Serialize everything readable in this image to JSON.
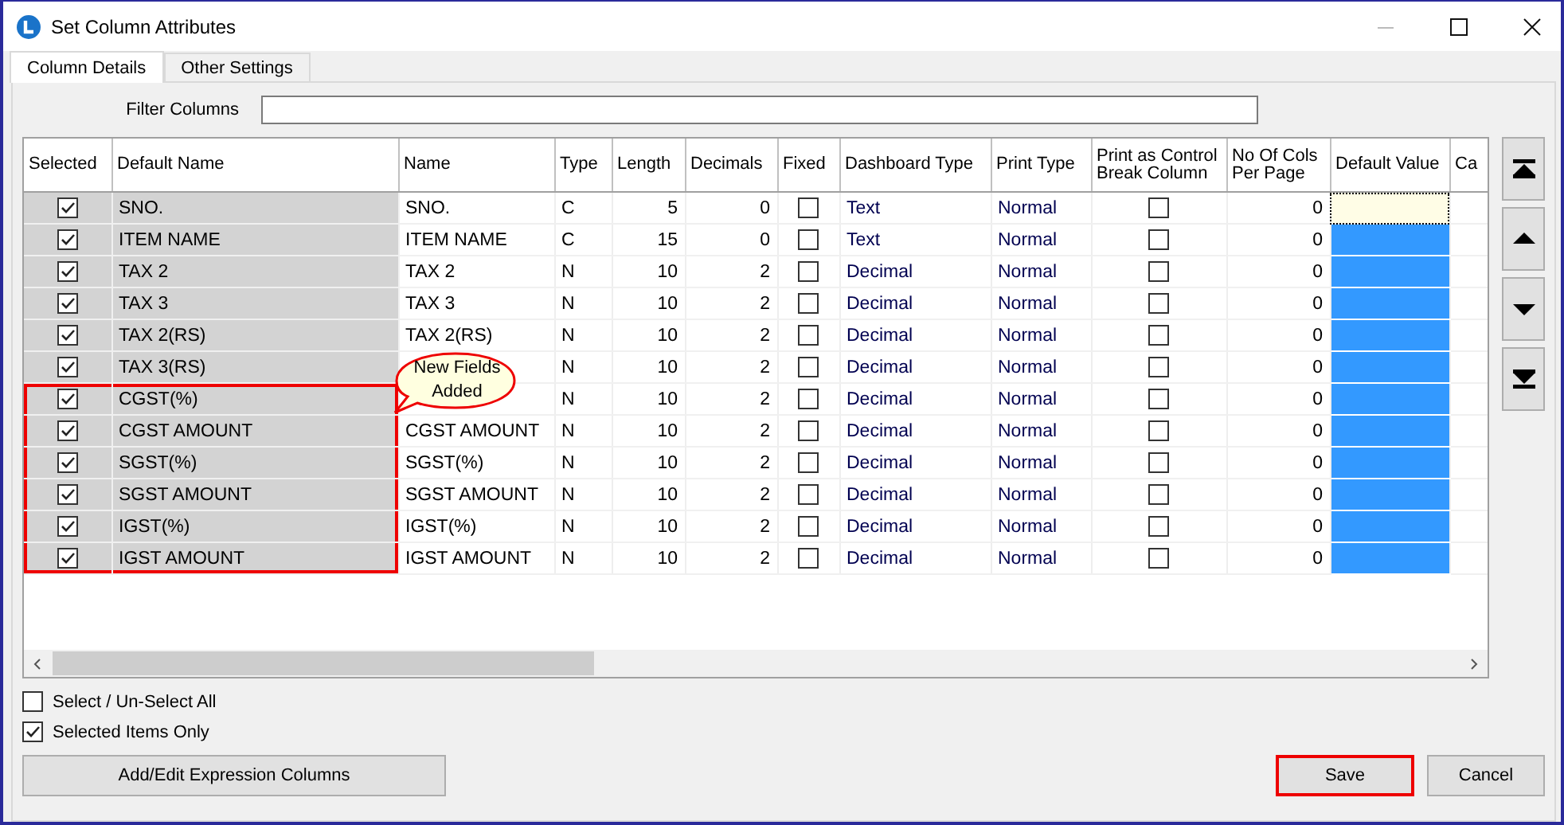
{
  "window": {
    "title": "Set Column Attributes"
  },
  "tabs": [
    {
      "label": "Column Details",
      "selected": true
    },
    {
      "label": "Other Settings",
      "selected": false
    }
  ],
  "filter": {
    "label": "Filter Columns"
  },
  "table": {
    "columns": [
      "Selected",
      "Default Name",
      "Name",
      "Type",
      "Length",
      "Decimals",
      "Fixed",
      "Dashboard Type",
      "Print Type",
      "Print as Control Break Column",
      "No Of Cols Per Page",
      "Default Value",
      "Ca"
    ],
    "rows": [
      {
        "selected_checked": true,
        "default_name": "SNO.",
        "name": "SNO.",
        "type": "C",
        "length": "5",
        "decimals": "0",
        "fixed": false,
        "dashboard_type": "Text",
        "print_type": "Normal",
        "control_break": false,
        "cols_per_page": "0",
        "focused": true,
        "marked": false
      },
      {
        "selected_checked": true,
        "default_name": "ITEM NAME",
        "name": "ITEM NAME",
        "type": "C",
        "length": "15",
        "decimals": "0",
        "fixed": false,
        "dashboard_type": "Text",
        "print_type": "Normal",
        "control_break": false,
        "cols_per_page": "0",
        "focused": false,
        "marked": false
      },
      {
        "selected_checked": true,
        "default_name": "TAX 2",
        "name": "TAX 2",
        "type": "N",
        "length": "10",
        "decimals": "2",
        "fixed": false,
        "dashboard_type": "Decimal",
        "print_type": "Normal",
        "control_break": false,
        "cols_per_page": "0",
        "focused": false,
        "marked": false
      },
      {
        "selected_checked": true,
        "default_name": "TAX 3",
        "name": "TAX 3",
        "type": "N",
        "length": "10",
        "decimals": "2",
        "fixed": false,
        "dashboard_type": "Decimal",
        "print_type": "Normal",
        "control_break": false,
        "cols_per_page": "0",
        "focused": false,
        "marked": false
      },
      {
        "selected_checked": true,
        "default_name": "TAX 2(RS)",
        "name": "TAX 2(RS)",
        "type": "N",
        "length": "10",
        "decimals": "2",
        "fixed": false,
        "dashboard_type": "Decimal",
        "print_type": "Normal",
        "control_break": false,
        "cols_per_page": "0",
        "focused": false,
        "marked": false
      },
      {
        "selected_checked": true,
        "default_name": "TAX 3(RS)",
        "type": "N",
        "length": "10",
        "decimals": "2",
        "fixed": false,
        "dashboard_type": "Decimal",
        "print_type": "Normal",
        "control_break": false,
        "cols_per_page": "0",
        "focused": false,
        "marked": false
      },
      {
        "selected_checked": true,
        "default_name": "CGST(%)",
        "type": "N",
        "length": "10",
        "decimals": "2",
        "fixed": false,
        "dashboard_type": "Decimal",
        "print_type": "Normal",
        "control_break": false,
        "cols_per_page": "0",
        "focused": false,
        "marked": true
      },
      {
        "selected_checked": true,
        "default_name": "CGST AMOUNT",
        "name": "CGST AMOUNT",
        "type": "N",
        "length": "10",
        "decimals": "2",
        "fixed": false,
        "dashboard_type": "Decimal",
        "print_type": "Normal",
        "control_break": false,
        "cols_per_page": "0",
        "focused": false,
        "marked": true
      },
      {
        "selected_checked": true,
        "default_name": "SGST(%)",
        "name": "SGST(%)",
        "type": "N",
        "length": "10",
        "decimals": "2",
        "fixed": false,
        "dashboard_type": "Decimal",
        "print_type": "Normal",
        "control_break": false,
        "cols_per_page": "0",
        "focused": false,
        "marked": true
      },
      {
        "selected_checked": true,
        "default_name": "SGST AMOUNT",
        "name": "SGST AMOUNT",
        "type": "N",
        "length": "10",
        "decimals": "2",
        "fixed": false,
        "dashboard_type": "Decimal",
        "print_type": "Normal",
        "control_break": false,
        "cols_per_page": "0",
        "focused": false,
        "marked": true
      },
      {
        "selected_checked": true,
        "default_name": "IGST(%)",
        "name": "IGST(%)",
        "type": "N",
        "length": "10",
        "decimals": "2",
        "fixed": false,
        "dashboard_type": "Decimal",
        "print_type": "Normal",
        "control_break": false,
        "cols_per_page": "0",
        "focused": false,
        "marked": true
      },
      {
        "selected_checked": true,
        "default_name": "IGST AMOUNT",
        "name": "IGST AMOUNT",
        "type": "N",
        "length": "10",
        "decimals": "2",
        "fixed": false,
        "dashboard_type": "Decimal",
        "print_type": "Normal",
        "control_break": false,
        "cols_per_page": "0",
        "focused": false,
        "marked": true
      }
    ]
  },
  "callout": {
    "lines": [
      "New Fields",
      "Added"
    ]
  },
  "options": [
    {
      "label": "Select / Un-Select All",
      "checked": false
    },
    {
      "label": "Selected Items Only",
      "checked": true
    }
  ],
  "buttons": [
    {
      "label": "Add/Edit Expression Columns",
      "highlighted": false
    },
    {
      "label": "Save",
      "highlighted": true
    },
    {
      "label": "Cancel",
      "highlighted": false
    }
  ]
}
